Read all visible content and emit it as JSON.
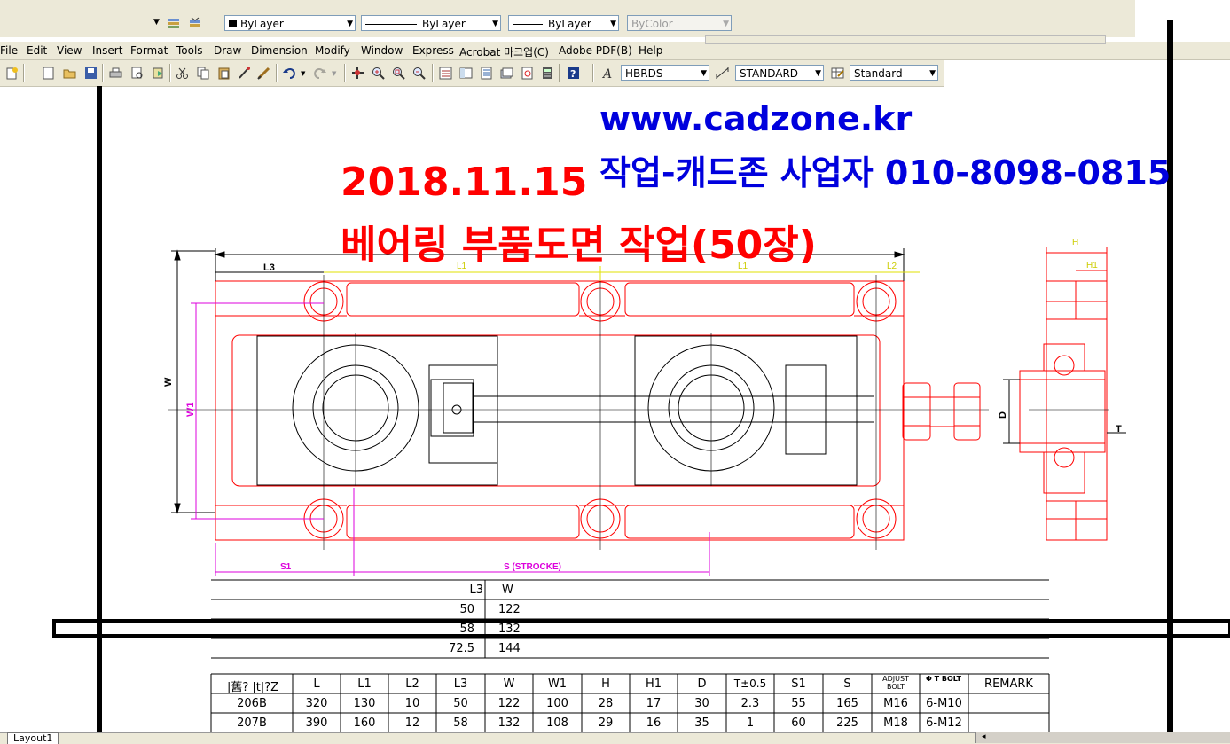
{
  "props": {
    "layer_combo": "ByLayer",
    "linetype_combo": "ByLayer",
    "lineweight_combo": "ByLayer",
    "plotstyle_combo": "ByColor"
  },
  "menu": [
    "File",
    "Edit",
    "View",
    "Insert",
    "Format",
    "Tools",
    "Draw",
    "Dimension",
    "Modify",
    "Window",
    "Express",
    "Acrobat 마크업(C)",
    "Adobe PDF(B)",
    "Help"
  ],
  "toolbar": {
    "text_style": "HBRDS",
    "dim_style": "STANDARD",
    "table_style": "Standard"
  },
  "banner": {
    "url": "www.cadzone.kr",
    "contact": "작업-캐드존 사업자 010-8098-0815",
    "date": "2018.11.15",
    "subtitle": "베어링 부품도면 작업(50장)"
  },
  "dims": {
    "l3": "L3",
    "l1a": "L1",
    "l1b": "L1",
    "l2": "L2",
    "h": "H",
    "h1": "H1",
    "w": "W",
    "w1": "W1",
    "d": "D",
    "t": "T",
    "s1": "S1",
    "s": "S (STROCKE)"
  },
  "table1": {
    "headers": [
      "L3",
      "W"
    ],
    "rows": [
      [
        "50",
        "122"
      ],
      [
        "58",
        "132"
      ],
      [
        "72.5",
        "144"
      ]
    ]
  },
  "table2": {
    "headers": [
      "|舊? |t|?Z",
      "L",
      "L1",
      "L2",
      "L3",
      "W",
      "W1",
      "H",
      "H1",
      "D",
      "T±0.5",
      "S1",
      "S",
      "ADJUST BOLT",
      "Φ T BOLT",
      "REMARK"
    ],
    "rows": [
      [
        "206B",
        "320",
        "130",
        "10",
        "50",
        "122",
        "100",
        "28",
        "17",
        "30",
        "2.3",
        "55",
        "165",
        "M16",
        "6-M10",
        ""
      ],
      [
        "207B",
        "390",
        "160",
        "12",
        "58",
        "132",
        "108",
        "29",
        "16",
        "35",
        "1",
        "60",
        "225",
        "M18",
        "6-M12",
        ""
      ]
    ]
  },
  "status": {
    "layout_tab": "Layout1"
  }
}
